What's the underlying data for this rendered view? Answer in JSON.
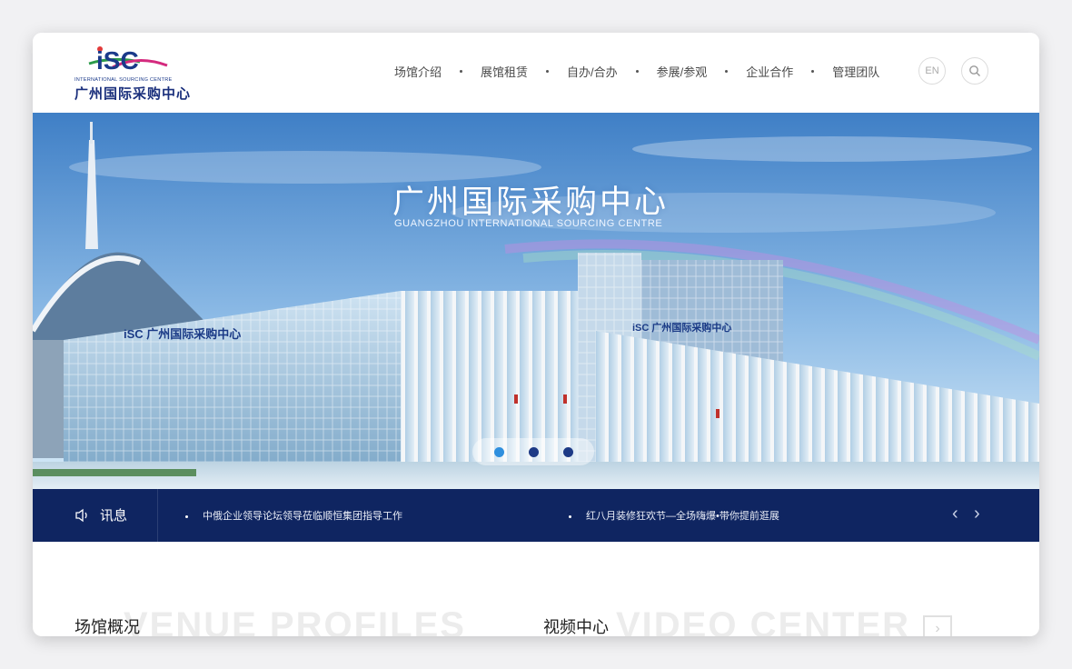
{
  "logo": {
    "mark": "iSC",
    "sub": "INTERNATIONAL SOURCING CENTRE",
    "name": "广州国际采购中心"
  },
  "nav": {
    "items": [
      "场馆介绍",
      "展馆租赁",
      "自办/合办",
      "参展/参观",
      "企业合作",
      "管理团队"
    ],
    "lang_button": "EN",
    "search_icon": "search-icon"
  },
  "banner": {
    "title": "广州国际采购中心",
    "subtitle": "GUANGZHOU INTERNATIONAL SOURCING CENTRE",
    "slides_total": 3,
    "active_slide": 1
  },
  "news": {
    "label": "讯息",
    "items": [
      "中俄企业领导论坛领导莅临顺恒集团指导工作",
      "红八月装修狂欢节—全场嗨爆•带你提前逛展"
    ]
  },
  "sections": {
    "venue": {
      "title": "场馆概况",
      "ghost": "VENUE PROFILES"
    },
    "video": {
      "title": "视频中心",
      "ghost": "VIDEO CENTER"
    }
  },
  "colors": {
    "navy": "#0f2561",
    "accent_blue": "#2f8fde",
    "sky": "#5b93d0"
  }
}
